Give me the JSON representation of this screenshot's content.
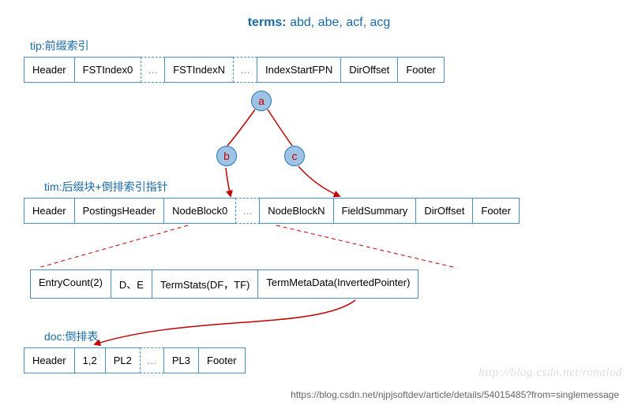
{
  "header": {
    "terms_prefix": "terms:",
    "terms_value": "abd, abe, acf, acg"
  },
  "labels": {
    "tip": "tip:前缀索引",
    "tim": "tim:后缀块+倒排索引指针",
    "doc": "doc:倒排表"
  },
  "rows": {
    "tip": {
      "cells": [
        "Header",
        "FSTIndex0",
        "…",
        "FSTIndexN",
        "…",
        "IndexStartFPN",
        "DirOffset",
        "Footer"
      ],
      "dashed_idx": [
        2,
        4
      ]
    },
    "tim": {
      "cells": [
        "Header",
        "PostingsHeader",
        "NodeBlock0",
        "…",
        "NodeBlockN",
        "FieldSummary",
        "DirOffset",
        "Footer"
      ],
      "dashed_idx": [
        3
      ]
    },
    "detail": {
      "cells": [
        "EntryCount(2)",
        "D、E",
        "TermStats(DF，TF)",
        "TermMetaData(InvertedPointer)"
      ],
      "dashed_idx": []
    },
    "doc": {
      "cells": [
        "Header",
        "1,2",
        "PL2",
        "…",
        "PL3",
        "Footer"
      ],
      "dashed_idx": [
        3
      ]
    }
  },
  "tree": {
    "nodes": {
      "a": "a",
      "b": "b",
      "c": "c"
    }
  },
  "watermark": "http://blog.csdn.net/ronalod",
  "citation": "https://blog.csdn.net/njpjsoftdev/article/details/54015485?from=singlemessage"
}
